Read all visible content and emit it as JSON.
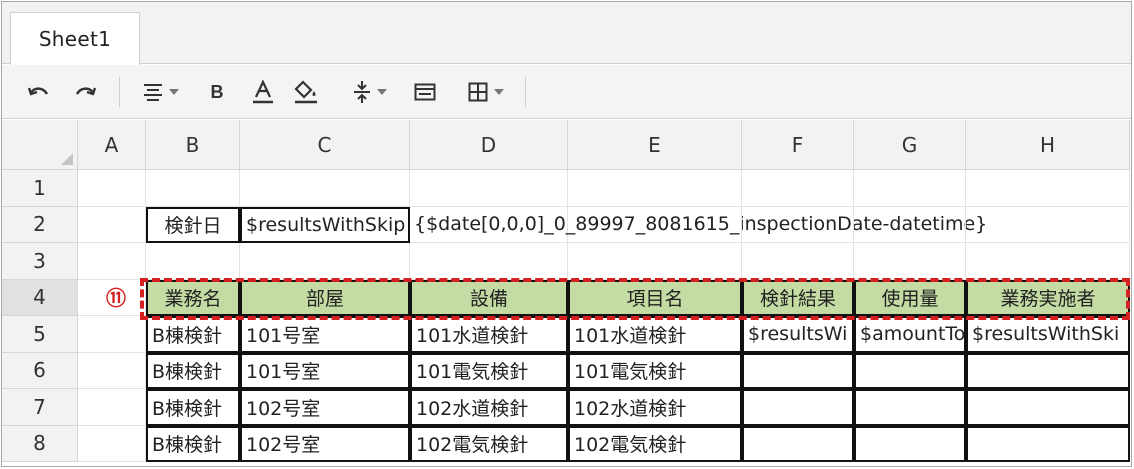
{
  "tabs": [
    {
      "label": "Sheet1",
      "active": true
    }
  ],
  "toolbar": {
    "bold_label": "B"
  },
  "columns": [
    "A",
    "B",
    "C",
    "D",
    "E",
    "F",
    "G",
    "H"
  ],
  "rows": [
    "1",
    "2",
    "3",
    "4",
    "5",
    "6",
    "7",
    "8"
  ],
  "cells": {
    "B2": "検針日",
    "C2": "$resultsWithSkip",
    "D2": "{$date[0,0,0]_0_89997_8081615_inspectionDate-datetime}",
    "B4": "業務名",
    "C4": "部屋",
    "D4": "設備",
    "E4": "項目名",
    "F4": "検針結果",
    "G4": "使用量",
    "H4": "業務実施者",
    "B5": "B棟検針",
    "C5": "101号室",
    "D5": "101水道検針",
    "E5": "101水道検針",
    "F5": "$resultsWi",
    "G5": "$amountTo",
    "H5": "$resultsWithSki",
    "B6": "B棟検針",
    "C6": "101号室",
    "D6": "101電気検針",
    "E6": "101電気検針",
    "B7": "B棟検針",
    "C7": "102号室",
    "D7": "102水道検針",
    "E7": "102水道検針",
    "B8": "B棟検針",
    "C8": "102号室",
    "D8": "102電気検針",
    "E8": "102電気検針"
  },
  "annotation": {
    "marker": "⑪",
    "color": "#d42020"
  },
  "colors": {
    "header_fill": "#c4dca3",
    "highlight": "#d42020"
  }
}
